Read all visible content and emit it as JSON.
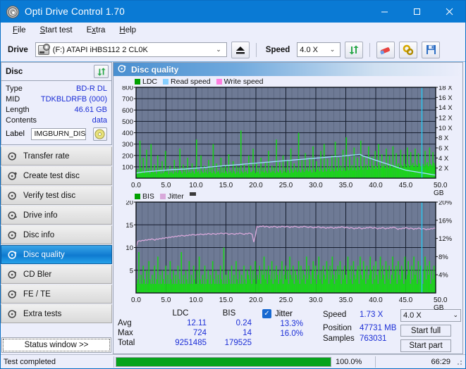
{
  "window": {
    "title": "Opti Drive Control 1.70",
    "icon": "disc-icon",
    "minimize": "−",
    "maximize": "□",
    "close": "✕",
    "accent": "#0a7ad4"
  },
  "menu": {
    "items": [
      {
        "label": "File",
        "accel": "F"
      },
      {
        "label": "Start test",
        "accel": "S"
      },
      {
        "label": "Extra",
        "accel": "x"
      },
      {
        "label": "Help",
        "accel": "H"
      }
    ]
  },
  "toolbar": {
    "drive_label": "Drive",
    "drive_value": "(F:)  ATAPI iHBS112  2 CL0K",
    "eject_icon": "eject-icon",
    "speed_label": "Speed",
    "speed_value": "4.0 X",
    "refresh_icon": "refresh-icon",
    "erase_icon": "eraser-icon",
    "settings_icon": "gears-icon",
    "save_icon": "save-icon"
  },
  "sidebar": {
    "disc_panel_title": "Disc",
    "refresh_icon": "refresh-icon",
    "disc_info": [
      {
        "key": "Type",
        "value": "BD-R DL"
      },
      {
        "key": "MID",
        "value": "TDKBLDRFB (000)"
      },
      {
        "key": "Length",
        "value": "46.61 GB"
      },
      {
        "key": "Contents",
        "value": "data"
      }
    ],
    "label_key": "Label",
    "label_value": "IMGBURN_DIS",
    "disc_icon": "cd-disc-icon",
    "nav": [
      {
        "label": "Transfer rate",
        "icon": "disc-speed-icon",
        "active": false
      },
      {
        "label": "Create test disc",
        "icon": "disc-write-icon",
        "active": false
      },
      {
        "label": "Verify test disc",
        "icon": "disc-check-icon",
        "active": false
      },
      {
        "label": "Drive info",
        "icon": "drive-info-icon",
        "active": false
      },
      {
        "label": "Disc info",
        "icon": "disc-info-icon",
        "active": false
      },
      {
        "label": "Disc quality",
        "icon": "disc-quality-icon",
        "active": true
      },
      {
        "label": "CD Bler",
        "icon": "disc-bler-icon",
        "active": false
      },
      {
        "label": "FE / TE",
        "icon": "disc-fete-icon",
        "active": false
      },
      {
        "label": "Extra tests",
        "icon": "disc-extra-icon",
        "active": false
      }
    ],
    "status_window_button": "Status window >>"
  },
  "panel": {
    "title": "Disc quality",
    "icon": "disc-quality-icon"
  },
  "chart_data": [
    {
      "type": "area",
      "name": "ldc-chart",
      "title": "",
      "xlabel": "GB",
      "ylabel": "",
      "ylim": [
        0,
        800
      ],
      "yticks": [
        100,
        200,
        300,
        400,
        500,
        600,
        700,
        800
      ],
      "y2lim": [
        0,
        18
      ],
      "y2ticks": [
        "2 X",
        "4 X",
        "6 X",
        "8 X",
        "10 X",
        "12 X",
        "14 X",
        "16 X",
        "18 X"
      ],
      "xlim": [
        0,
        50
      ],
      "xticks": [
        "0.0",
        "5.0",
        "10.0",
        "15.0",
        "20.0",
        "25.0",
        "30.0",
        "35.0",
        "40.0",
        "45.0",
        "50.0"
      ],
      "x_unit": "GB",
      "grid": true,
      "plot_bg": "#6e7a95",
      "legend": [
        {
          "label": "LDC",
          "color": "#00a000"
        },
        {
          "label": "Read speed",
          "color": "#87cfff"
        },
        {
          "label": "Write speed",
          "color": "#ff7fe0"
        }
      ],
      "series": [
        {
          "name": "LDC",
          "color": "#1ad41a",
          "kind": "spikes",
          "values": [
            60,
            80,
            40,
            330,
            90,
            60,
            180,
            45,
            70,
            250,
            55,
            90,
            40,
            300,
            60,
            50,
            120,
            70,
            40,
            200,
            60,
            95,
            40,
            150,
            45,
            60,
            240,
            55,
            70,
            35,
            110,
            50,
            65,
            40,
            160,
            55,
            95,
            45,
            70,
            260,
            60,
            40,
            120,
            55,
            90,
            40,
            180,
            50,
            70,
            45,
            130,
            60,
            40,
            95,
            340,
            55,
            70,
            40,
            200,
            60,
            45,
            110,
            50,
            75,
            40,
            160,
            55,
            95,
            45,
            300,
            60,
            40,
            130,
            55,
            70,
            40,
            180,
            50,
            95,
            45,
            120,
            60,
            40,
            210,
            55,
            70,
            45,
            150,
            60,
            40,
            110,
            55,
            95,
            40,
            420,
            60,
            45,
            130,
            55,
            70,
            40,
            200,
            95,
            50,
            60,
            260,
            70,
            45,
            130,
            55,
            90,
            40,
            180,
            60,
            95,
            50,
            140,
            65,
            45,
            240,
            70,
            50,
            110,
            60,
            95,
            45,
            340,
            60,
            50,
            140,
            70,
            45,
            200,
            60,
            95,
            50,
            160,
            70,
            45,
            260,
            80,
            50,
            130,
            70,
            95,
            55,
            400,
            70,
            50,
            160,
            80,
            55,
            220,
            70,
            95,
            60,
            180,
            75,
            50,
            280,
            85,
            55,
            150,
            75,
            100,
            60,
            240,
            80,
            55,
            300,
            90,
            60,
            170,
            80,
            105,
            60,
            200,
            85,
            60,
            320,
            95,
            65,
            180,
            85,
            110,
            65,
            250,
            90,
            65,
            360,
            100,
            70,
            190,
            90,
            115,
            70,
            270,
            95,
            70,
            180,
            100,
            75,
            330,
            105,
            75,
            200,
            95,
            120,
            75,
            280,
            100,
            75,
            190,
            110,
            80,
            240,
            105,
            80,
            300,
            115,
            85,
            210,
            105,
            125,
            85,
            260,
            110,
            85,
            200,
            120,
            90,
            280,
            115,
            90,
            220,
            110,
            130,
            90,
            250,
            115,
            95,
            210,
            125,
            95,
            270,
            120,
            100,
            230,
            115,
            135,
            100,
            260,
            120,
            100,
            220,
            130,
            105,
            280,
            125,
            105,
            240,
            120,
            140,
            105,
            270,
            125,
            110,
            230,
            135,
            110
          ]
        },
        {
          "name": "Read speed",
          "color": "#9fe0ff",
          "kind": "line",
          "values": [
            1.0,
            1.1,
            1.2,
            1.25,
            1.3,
            1.35,
            1.4,
            1.45,
            1.5,
            1.55,
            1.6,
            1.65,
            1.7,
            1.72,
            1.75,
            1.78,
            1.8,
            1.85,
            1.9,
            1.95,
            2.0,
            2.05,
            2.1,
            2.15,
            2.2,
            2.25,
            2.3,
            2.35,
            2.4,
            2.45,
            2.5,
            2.55,
            2.6,
            2.65,
            2.7,
            2.75,
            2.8,
            2.85,
            2.9,
            2.95,
            3.0,
            3.05,
            3.1,
            3.15,
            3.2,
            3.25,
            3.3,
            3.35,
            3.4,
            3.45,
            3.5,
            3.55,
            3.6,
            3.65,
            3.7,
            3.75,
            3.8,
            3.85,
            3.9,
            3.95,
            4.0,
            4.05,
            4.1,
            4.15,
            4.2,
            4.25,
            4.3,
            4.35,
            4.4,
            4.45,
            4.5,
            4.55,
            4.6,
            4.65,
            4.7,
            4.4,
            4.2,
            4.0,
            3.8,
            3.6,
            3.4,
            3.2,
            3.0,
            2.8,
            2.6,
            2.4,
            2.2,
            2.0,
            1.8,
            1.6,
            1.5,
            1.4,
            1.3,
            1.2,
            1.1,
            1.0,
            0.9,
            0.8,
            0.7,
            0.6
          ]
        }
      ],
      "markers": [
        {
          "name": "cursor",
          "x": 47.7,
          "color": "#29c6f0"
        }
      ]
    },
    {
      "type": "area",
      "name": "bis-jitter-chart",
      "title": "",
      "xlabel": "GB",
      "ylim": [
        0,
        20
      ],
      "yticks": [
        5,
        10,
        15,
        20
      ],
      "y2lim": [
        0,
        20
      ],
      "y2ticks": [
        "4%",
        "8%",
        "12%",
        "16%",
        "20%"
      ],
      "xlim": [
        0,
        50
      ],
      "xticks": [
        "0.0",
        "5.0",
        "10.0",
        "15.0",
        "20.0",
        "25.0",
        "30.0",
        "35.0",
        "40.0",
        "45.0",
        "50.0"
      ],
      "x_unit": "GB",
      "grid": true,
      "plot_bg": "#6e7a95",
      "legend": [
        {
          "label": "BIS",
          "color": "#00a000"
        },
        {
          "label": "Jitter",
          "color": "#d8a8da"
        }
      ],
      "series": [
        {
          "name": "BIS",
          "color": "#1ad41a",
          "kind": "spikes",
          "values": [
            2,
            3,
            9,
            2,
            4,
            2,
            6,
            3,
            2,
            5,
            2,
            7,
            3,
            2,
            4,
            2,
            6,
            2,
            3,
            8,
            2,
            4,
            2,
            5,
            3,
            2,
            6,
            2,
            4,
            2,
            7,
            3,
            2,
            5,
            2,
            4,
            2,
            6,
            3,
            2,
            9,
            2,
            4,
            2,
            5,
            3,
            2,
            7,
            2,
            4,
            2,
            6,
            3,
            2,
            5,
            2,
            8,
            3,
            2,
            4,
            2,
            6,
            2,
            3,
            5,
            2,
            4,
            2,
            7,
            3,
            2,
            5,
            2,
            4,
            2,
            6,
            3,
            2,
            10,
            2,
            4,
            2,
            5,
            3,
            2,
            6,
            2,
            4,
            2,
            7,
            3,
            2,
            5,
            2,
            4,
            2,
            6,
            3,
            2,
            5,
            4,
            3,
            6,
            2,
            5,
            3,
            7,
            2,
            4,
            3,
            6,
            2,
            5,
            4,
            8,
            3,
            5,
            2,
            6,
            4,
            3,
            7,
            2,
            5,
            3,
            6,
            4,
            2,
            5,
            3,
            7,
            2,
            4,
            6,
            3,
            5,
            2,
            8,
            4,
            3,
            6,
            2,
            5,
            4,
            3,
            7,
            2,
            6,
            3,
            5,
            4,
            2,
            8,
            3,
            6,
            4,
            2,
            5,
            7,
            3,
            6,
            2,
            4,
            8,
            3,
            5,
            2,
            6,
            4,
            3,
            7,
            5,
            2,
            6,
            3,
            8,
            4,
            2,
            5,
            3,
            6,
            4,
            7,
            2,
            5,
            3,
            6,
            4,
            2,
            8,
            5,
            3,
            6,
            2,
            7,
            4,
            3,
            5,
            6,
            2,
            8,
            4,
            3,
            7,
            5,
            2,
            6,
            3,
            4,
            8,
            5,
            2,
            6,
            3,
            7,
            4,
            2,
            5,
            8,
            3,
            6,
            4,
            2,
            7,
            5,
            3,
            6,
            2,
            4,
            8,
            3,
            5,
            6,
            2,
            7,
            4,
            3,
            6,
            5,
            2,
            8,
            3,
            4,
            7,
            5,
            2,
            6,
            3,
            8,
            4,
            5,
            2,
            7,
            3,
            6,
            4,
            2,
            5,
            8,
            3,
            6,
            4,
            7,
            2,
            5,
            3,
            6,
            4
          ]
        },
        {
          "name": "Jitter",
          "color": "#d8a8da",
          "kind": "line",
          "values": [
            10.0,
            11.3,
            11.5,
            11.4,
            11.6,
            11.5,
            11.7,
            11.6,
            11.8,
            11.7,
            11.9,
            11.8,
            11.6,
            11.9,
            11.8,
            12.0,
            11.9,
            12.1,
            12.0,
            12.2,
            12.1,
            12.3,
            12.2,
            12.4,
            12.3,
            12.5,
            12.4,
            12.6,
            12.5,
            12.7,
            12.6,
            12.5,
            12.7,
            12.6,
            12.8,
            12.7,
            12.9,
            12.8,
            12.7,
            12.9,
            12.8,
            13.0,
            12.9,
            12.8,
            13.0,
            12.9,
            13.1,
            13.0,
            12.9,
            13.1,
            13.0,
            12.9,
            13.1,
            13.0,
            13.2,
            13.1,
            13.0,
            13.2,
            13.1,
            12.9,
            13.0,
            13.1,
            13.0,
            12.9,
            13.1,
            13.0,
            13.2,
            13.1,
            13.0,
            12.9,
            13.1,
            13.0,
            13.2,
            13.1,
            12.9,
            11.2,
            12.4,
            14.6,
            14.5,
            14.7,
            14.6,
            14.8,
            14.5,
            14.7,
            14.6,
            14.4,
            14.6,
            14.5,
            14.7,
            14.6,
            14.4,
            14.6,
            14.5,
            14.7,
            14.6,
            14.5,
            14.7,
            14.6,
            14.4,
            14.6,
            14.5,
            14.7,
            14.6,
            14.5,
            14.4,
            14.6,
            14.5,
            14.7,
            14.6,
            14.5,
            14.4,
            14.6,
            14.5,
            14.3,
            14.5,
            14.4,
            14.6,
            14.5,
            14.3,
            14.5,
            14.4,
            14.2,
            14.4,
            14.3,
            14.5,
            14.4,
            14.2,
            14.4,
            14.3,
            14.5,
            14.4,
            14.6,
            14.5,
            14.3,
            14.5,
            14.4,
            14.2,
            14.4,
            14.3,
            14.1,
            14.3,
            14.2,
            14.4,
            14.3,
            14.1,
            14.3,
            14.2,
            14.4,
            14.3,
            14.5,
            14.4,
            14.2,
            14.4,
            14.3,
            14.1,
            14.3,
            14.2,
            14.4,
            14.3,
            14.1,
            14.3,
            14.2,
            14.4,
            14.3,
            14.5,
            14.4,
            14.2,
            14.0,
            14.2,
            14.1,
            14.3,
            14.2,
            14.4,
            14.3,
            14.1,
            14.3,
            14.2,
            14.0,
            14.2,
            14.1,
            14.3,
            14.2,
            14.0,
            14.2,
            14.1,
            13.9,
            14.1,
            14.0,
            14.2,
            14.1,
            14.3,
            14.2
          ]
        }
      ],
      "markers": [
        {
          "name": "cursor",
          "x": 47.7,
          "color": "#29c6f0"
        }
      ]
    }
  ],
  "stats": {
    "col_headers": [
      "",
      "LDC",
      "BIS"
    ],
    "rows": [
      {
        "label": "Avg",
        "ldc": "12.11",
        "bis": "0.24"
      },
      {
        "label": "Max",
        "ldc": "724",
        "bis": "14"
      },
      {
        "label": "Total",
        "ldc": "9251485",
        "bis": "179525"
      }
    ],
    "jitter": {
      "checked": true,
      "label": "Jitter",
      "check_glyph": "✓",
      "avg": "13.3%",
      "max": "16.0%"
    },
    "readout": [
      {
        "key": "Speed",
        "value": "1.73 X"
      },
      {
        "key": "Position",
        "value": "47731 MB"
      },
      {
        "key": "Samples",
        "value": "763031"
      }
    ],
    "speed_select": "4.0 X",
    "start_full_button": "Start full",
    "start_part_button": "Start part"
  },
  "statusbar": {
    "message": "Test completed",
    "progress_percent": "100.0%",
    "progress_value": 100,
    "elapsed": "66:29",
    "progress_color": "#07a31c"
  }
}
